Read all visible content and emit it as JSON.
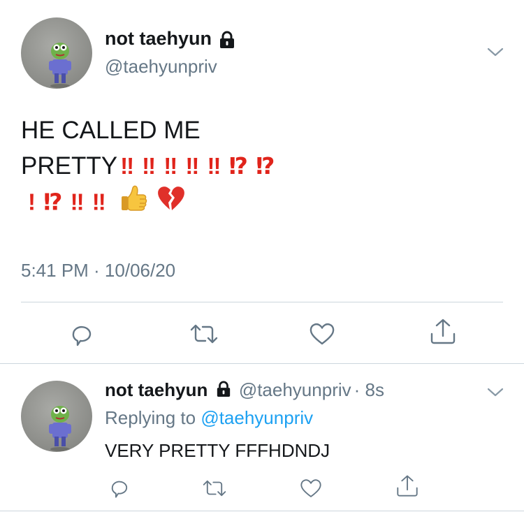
{
  "main_tweet": {
    "display_name": "not taehyun",
    "handle": "@taehyunpriv",
    "text_line1": "HE CALLED ME",
    "text_line2_word": "PRETTY",
    "text_line2_marks": "‼ ‼ ‼ ‼ ‼ ⁉ ⁉",
    "text_line3_marks": "! ⁉ ‼ ‼",
    "emoji_1": "thumbs-up",
    "emoji_2": "broken-heart",
    "timestamp": "5:41 PM · 10/06/20"
  },
  "reply_tweet": {
    "display_name": "not taehyun",
    "handle": "@taehyunpriv",
    "time_ago": "· 8s",
    "replying_prefix": "Replying to",
    "replying_to": "@taehyunpriv",
    "text": "VERY PRETTY FFFHDNDJ"
  },
  "icons": {
    "menu": "chevron-down-icon",
    "lock": "lock-icon",
    "reply": "reply-icon",
    "retweet": "retweet-icon",
    "like": "heart-icon",
    "share": "share-icon"
  },
  "colors": {
    "text": "#14171a",
    "muted": "#657786",
    "link": "#1da1f2",
    "divider": "#ccd6dd",
    "exclamation": "#e0241b"
  }
}
